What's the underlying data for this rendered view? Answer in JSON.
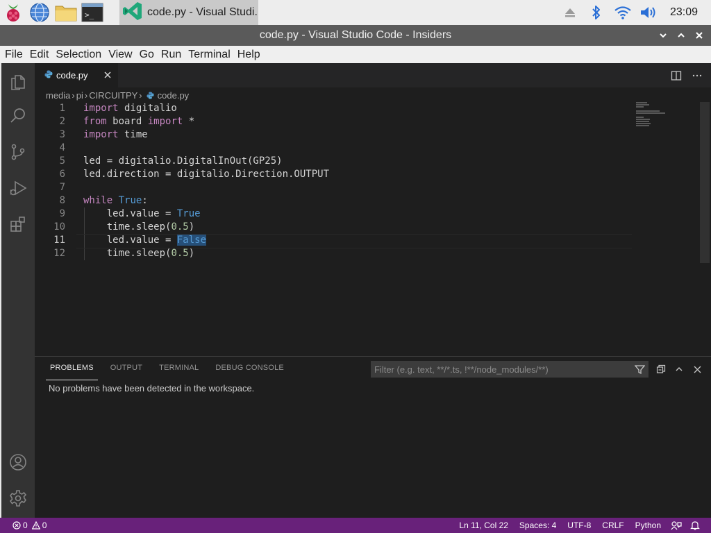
{
  "taskbar": {
    "launchers": [
      "raspberry-menu-icon",
      "web-browser-icon",
      "file-manager-icon",
      "terminal-icon"
    ],
    "active_app": {
      "icon": "vscode-insiders-icon",
      "label": "code.py - Visual Studi..."
    },
    "tray": [
      "eject-icon",
      "bluetooth-icon",
      "wifi-icon",
      "volume-icon"
    ],
    "clock": "23:09"
  },
  "window": {
    "title": "code.py - Visual Studio Code - Insiders"
  },
  "menu": [
    "File",
    "Edit",
    "Selection",
    "View",
    "Go",
    "Run",
    "Terminal",
    "Help"
  ],
  "activity_bar": {
    "top": [
      "explorer-icon",
      "search-icon",
      "source-control-icon",
      "run-debug-icon",
      "extensions-icon"
    ],
    "bottom": [
      "accounts-icon",
      "manage-gear-icon"
    ]
  },
  "editor": {
    "tab": {
      "label": "code.py",
      "icon": "python-file-icon"
    },
    "breadcrumb": [
      "media",
      "pi",
      "CIRCUITPY",
      "code.py"
    ],
    "active_line": 11,
    "lines": [
      [
        {
          "t": "import",
          "c": "kw"
        },
        {
          "t": " digitalio",
          "c": ""
        }
      ],
      [
        {
          "t": "from",
          "c": "kw"
        },
        {
          "t": " board ",
          "c": ""
        },
        {
          "t": "import",
          "c": "kw"
        },
        {
          "t": " *",
          "c": ""
        }
      ],
      [
        {
          "t": "import",
          "c": "kw"
        },
        {
          "t": " time",
          "c": ""
        }
      ],
      [],
      [
        {
          "t": "led = digitalio.DigitalInOut(GP25)",
          "c": ""
        }
      ],
      [
        {
          "t": "led.direction = digitalio.Direction.OUTPUT",
          "c": ""
        }
      ],
      [],
      [
        {
          "t": "while",
          "c": "kw"
        },
        {
          "t": " ",
          "c": ""
        },
        {
          "t": "True",
          "c": "const"
        },
        {
          "t": ":",
          "c": ""
        }
      ],
      [
        {
          "t": "    led.value = ",
          "c": ""
        },
        {
          "t": "True",
          "c": "const"
        }
      ],
      [
        {
          "t": "    time.sleep(",
          "c": ""
        },
        {
          "t": "0.5",
          "c": "num"
        },
        {
          "t": ")",
          "c": ""
        }
      ],
      [
        {
          "t": "    led.value = ",
          "c": ""
        },
        {
          "t": "False",
          "c": "const sel"
        }
      ],
      [
        {
          "t": "    time.sleep(",
          "c": ""
        },
        {
          "t": "0.5",
          "c": "num"
        },
        {
          "t": ")",
          "c": ""
        }
      ]
    ]
  },
  "panel": {
    "tabs": [
      "PROBLEMS",
      "OUTPUT",
      "TERMINAL",
      "DEBUG CONSOLE"
    ],
    "active_tab": "PROBLEMS",
    "filter_placeholder": "Filter (e.g. text, **/*.ts, !**/node_modules/**)",
    "message": "No problems have been detected in the workspace."
  },
  "status": {
    "errors": "0",
    "warnings": "0",
    "position": "Ln 11, Col 22",
    "spaces": "Spaces: 4",
    "encoding": "UTF-8",
    "eol": "CRLF",
    "language": "Python"
  },
  "colors": {
    "status_bar": "#68217a",
    "keyword": "#c586c0",
    "constant": "#569cd6",
    "number": "#b5cea8"
  }
}
